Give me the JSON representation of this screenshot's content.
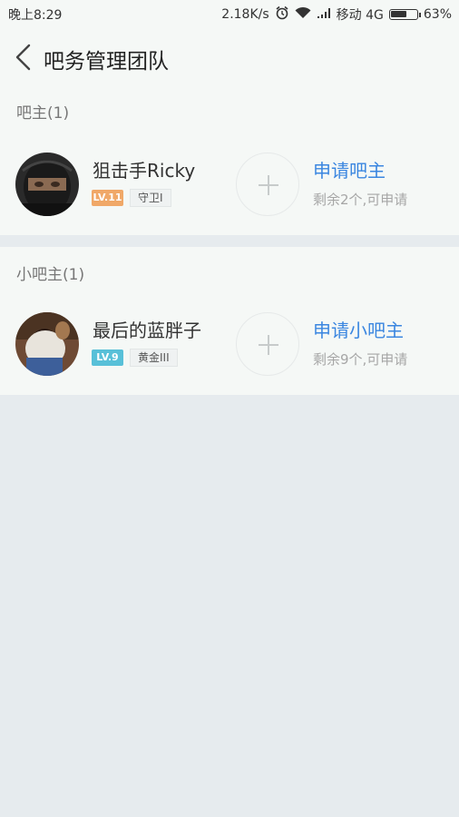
{
  "status_bar": {
    "time": "晚上8:29",
    "speed": "2.18K/s",
    "carrier": "移动 4G",
    "battery": "63%",
    "battery_level": 0.63,
    "icons": [
      "alarm-icon",
      "wifi-icon",
      "signal-icon",
      "battery-icon"
    ]
  },
  "nav": {
    "back_icon": "chevron-left-icon",
    "title": "吧务管理团队"
  },
  "sections": [
    {
      "title": "吧主(1)",
      "member": {
        "name": "狙击手Ricky",
        "level": "LV.11",
        "level_color": "#f0a868",
        "rank": "守卫I"
      },
      "apply": {
        "label": "申请吧主",
        "remain": "剩余2个,可申请"
      }
    },
    {
      "title": "小吧主(1)",
      "member": {
        "name": "最后的蓝胖子",
        "level": "LV.9",
        "level_color": "#58c0d8",
        "rank": "黄金III"
      },
      "apply": {
        "label": "申请小吧主",
        "remain": "剩余9个,可申请"
      }
    }
  ],
  "colors": {
    "accent": "#3a86e0",
    "background": "#e6ebee",
    "card": "#f5f8f6"
  }
}
